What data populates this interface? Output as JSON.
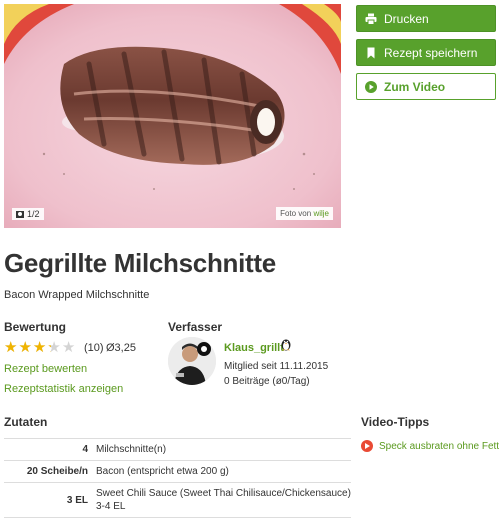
{
  "hero": {
    "counter": "1/2",
    "credit_prefix": "Foto von",
    "credit_user": "wilje"
  },
  "actions": {
    "print_label": "Drucken",
    "save_label": "Rezept speichern",
    "video_label": "Zum Video",
    "accent_color": "#58a12c"
  },
  "recipe": {
    "title": "Gegrillte Milchschnitte",
    "subtitle": "Bacon Wrapped Milchschnitte"
  },
  "rating": {
    "heading": "Bewertung",
    "stars_value": 3.25,
    "stars_max": 5,
    "count": "(10)",
    "average": "Ø3,25",
    "rate_link": "Rezept bewerten",
    "stats_link": "Rezeptstatistik anzeigen"
  },
  "author": {
    "heading": "Verfasser",
    "name": "Klaus_grillt",
    "member_since": "Mitglied seit 11.11.2015",
    "posts": "0 Beiträge (ø0/Tag)"
  },
  "ingredients": {
    "heading": "Zutaten",
    "rows": [
      {
        "amount": "4",
        "name": "Milchschnitte(n)"
      },
      {
        "amount": "20 Scheibe/n",
        "name": "Bacon (entspricht etwa 200 g)"
      },
      {
        "amount": "3 EL",
        "name": "Sweet Chili Sauce (Sweet Thai Chilisauce/Chickensauce) 3-4 EL"
      }
    ]
  },
  "video_tips": {
    "heading": "Video-Tipps",
    "items": [
      {
        "label": "Speck ausbraten ohne Fett"
      }
    ]
  }
}
